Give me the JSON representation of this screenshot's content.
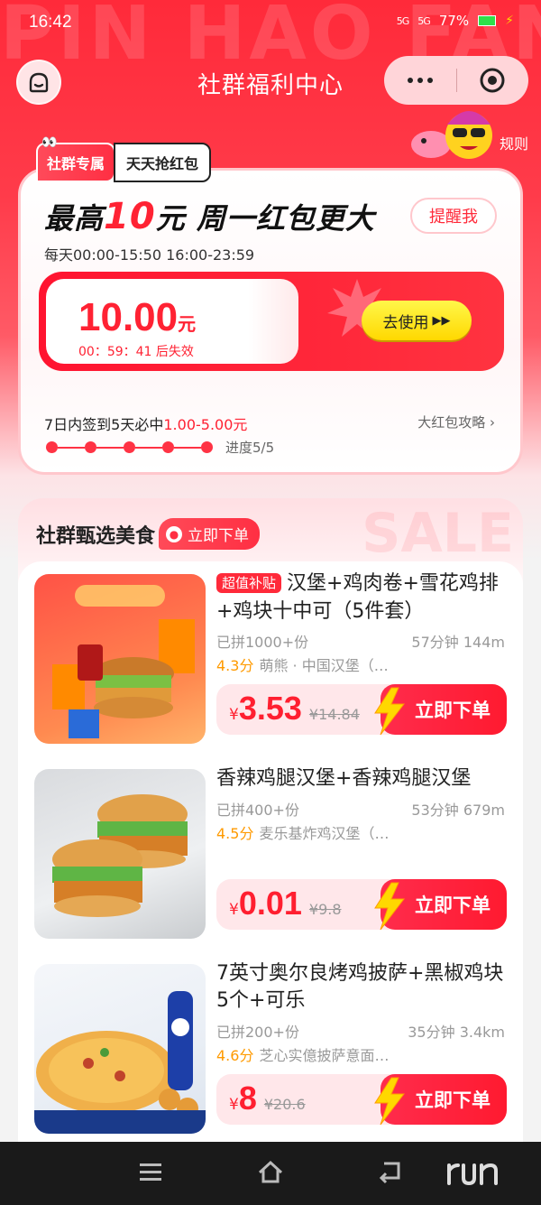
{
  "status": {
    "time": "16:42",
    "signal1": "5G",
    "signal2": "5G",
    "battery": "77%"
  },
  "nav": {
    "title": "社群福利中心",
    "rules": "规则"
  },
  "banner": {
    "tag_primary": "社群专属",
    "tag_secondary": "天天抢红包",
    "title_prefix": "最高",
    "title_number": "10",
    "title_suffix": "元 周一红包更大",
    "remind_label": "提醒我",
    "time_range": "每天00:00-15:50 16:00-23:59",
    "coupon_amount": "10.00",
    "coupon_unit": "元",
    "countdown": "00：59：41 后失效",
    "use_label": "去使用",
    "signin_text": "7日内签到5天必中",
    "signin_range": "1.00-5.00元",
    "strategy_label": "大红包攻略",
    "progress_label": "进度5/5",
    "progress": {
      "done": 5,
      "total": 5
    }
  },
  "food": {
    "section_title": "社群甄选美食",
    "order_pill": "立即下单",
    "items": [
      {
        "badge": "超值补贴",
        "name": "汉堡+鸡肉卷+雪花鸡排+鸡块十中可（5件套）",
        "sold": "已拼1000+份",
        "eta": "57分钟 144m",
        "score": "4.3分",
        "shop": "萌熊 · 中国汉堡（…",
        "currency": "¥",
        "price": "3.53",
        "original_price": "¥14.84",
        "buy_label": "立即下单"
      },
      {
        "badge": "",
        "name": "香辣鸡腿汉堡+香辣鸡腿汉堡",
        "sold": "已拼400+份",
        "eta": "53分钟 679m",
        "score": "4.5分",
        "shop": "麦乐基炸鸡汉堡（…",
        "currency": "¥",
        "price": "0.01",
        "original_price": "¥9.8",
        "buy_label": "立即下单"
      },
      {
        "badge": "",
        "name": "7英寸奥尔良烤鸡披萨+黑椒鸡块5个+可乐",
        "sold": "已拼200+份",
        "eta": "35分钟 3.4km",
        "score": "4.6分",
        "shop": "芝心实億披萨意面…",
        "currency": "¥",
        "price": "8",
        "original_price": "¥20.6",
        "buy_label": "立即下单"
      }
    ]
  },
  "colors": {
    "brand_red": "#ff2a3a",
    "accent_yellow": "#ffd800",
    "score_orange": "#ff9a00"
  }
}
